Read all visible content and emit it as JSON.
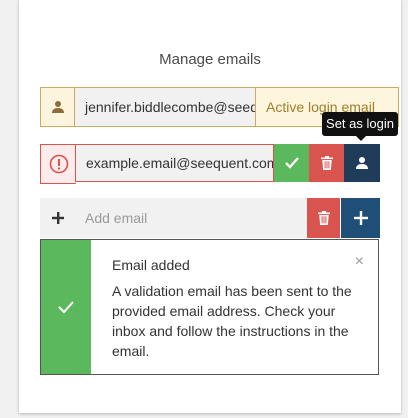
{
  "title": "Manage emails",
  "emails": [
    {
      "value": "jennifer.biddlecombe@seeq",
      "status_label": "Active login email"
    },
    {
      "value": "example.email@seequent.com"
    }
  ],
  "add_email": {
    "placeholder": "Add email"
  },
  "tooltip": "Set as login",
  "toast": {
    "heading": "Email added",
    "message": "A validation email has been sent to the provided email address. Check your inbox and follow the instructions in the email.",
    "close_glyph": "×"
  },
  "colors": {
    "warning_border": "#c9ab5f",
    "warning_text": "#a27e2a",
    "error": "#d9534f",
    "success": "#5cb85c",
    "primary_dark": "#1f3c58",
    "primary": "#1f4e78"
  },
  "icons": {
    "login_row": "user-icon",
    "error_row": "exclamation-circle-icon",
    "confirm": "check-icon",
    "delete": "trash-icon",
    "set_login": "user-icon",
    "add": "plus-icon",
    "toast": "check-icon"
  }
}
